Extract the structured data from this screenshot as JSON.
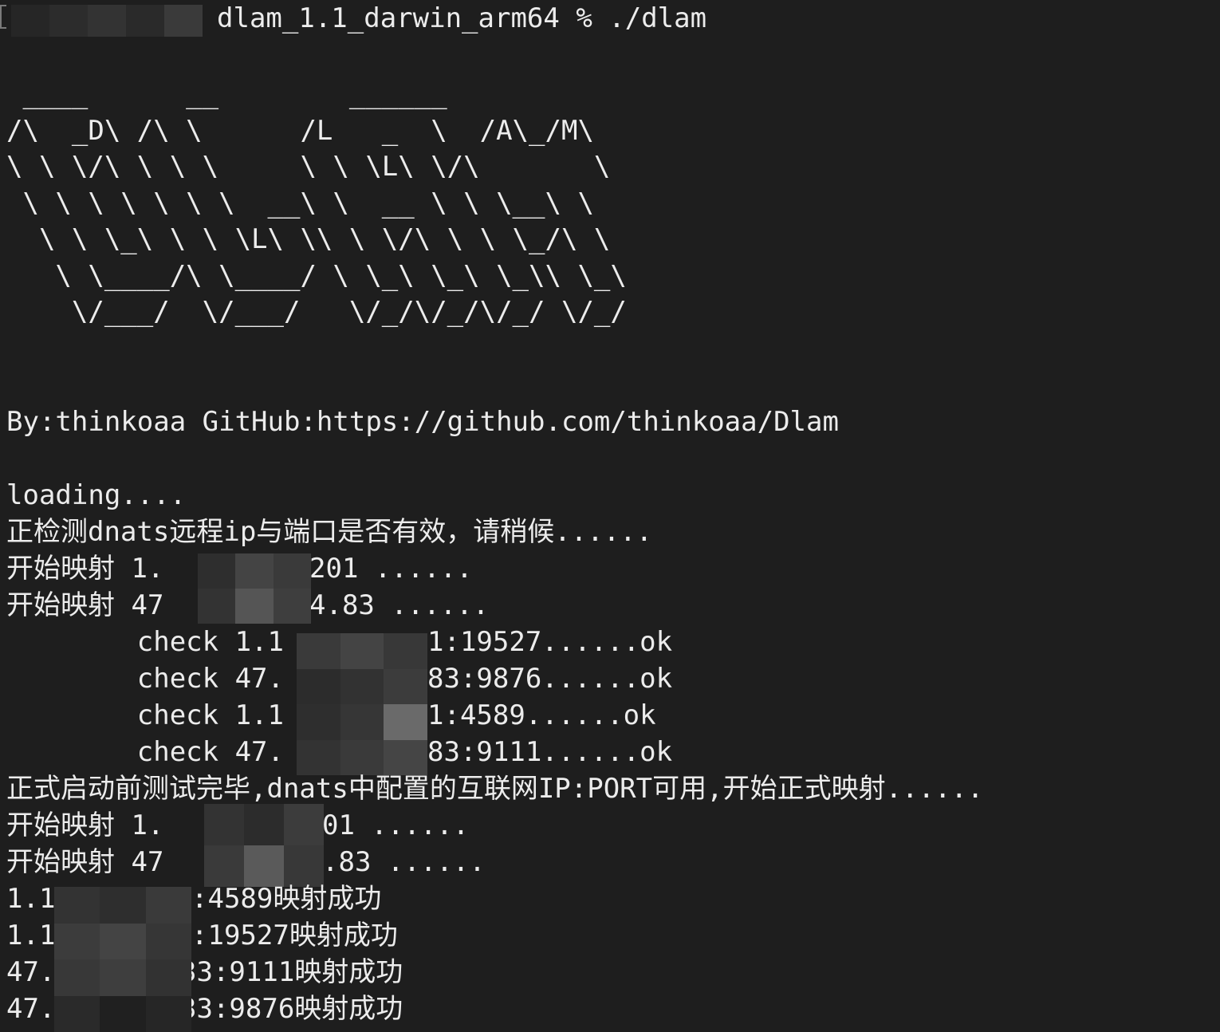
{
  "prompt": {
    "command_line": "dlam_1.1_darwin_arm64 % ./dlam"
  },
  "logo_ascii": " ____      __        ______\n/\\  _D\\ /\\ \\      /L   _  \\  /A\\_/M\\\n\\ \\ \\/\\ \\ \\ \\     \\ \\ \\L\\ \\/\\       \\\n \\ \\ \\ \\ \\ \\ \\  __\\ \\  __ \\ \\ \\__\\ \\\n  \\ \\ \\_\\ \\ \\ \\L\\ \\\\ \\ \\/\\ \\ \\ \\_/\\ \\\n   \\ \\____/\\ \\____/ \\ \\_\\ \\_\\ \\_\\\\ \\_\\\n    \\/___/  \\/___/   \\/_/\\/_/\\/_/ \\/_/",
  "credits": "By:thinkoaa GitHub:https://github.com/thinkoaa/Dlam",
  "output": {
    "loading": "loading....",
    "checking": "正检测dnats远程ip与端口是否有效，请稍候......",
    "map_start_1": "开始映射 1.",
    "map_start_1_tail": "201 ......",
    "map_start_2": "开始映射 47",
    "map_start_2_tail": "4.83 ......",
    "check_1": "        check 1.1",
    "check_1_tail": "1:19527......ok",
    "check_2": "        check 47.",
    "check_2_tail": "83:9876......ok",
    "check_3": "        check 1.1",
    "check_3_tail": "1:4589......ok",
    "check_4": "        check 47.",
    "check_4_tail": "83:9111......ok",
    "test_done": "正式启动前测试完毕,dnats中配置的互联网IP:PORT可用,开始正式映射......",
    "map_start_3": "开始映射 1.",
    "map_start_3_tail": "01 ......",
    "map_start_4": "开始映射 47",
    "map_start_4_tail": ".83 ......",
    "success_1": "1.1",
    "success_1_tail": ":4589映射成功",
    "success_2": "1.1",
    "success_2_tail": ":19527映射成功",
    "success_3": "47.",
    "success_3_tail": "33:9111映射成功",
    "success_4": "47.",
    "success_4_tail": "33:9876映射成功"
  },
  "colors": {
    "background": "#1e1e1e",
    "foreground": "#ececec"
  }
}
